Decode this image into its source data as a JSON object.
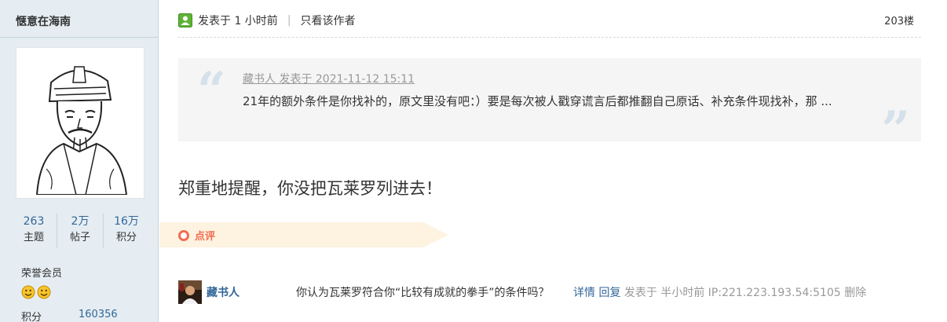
{
  "user": {
    "name": "惬意在海南",
    "stats": [
      {
        "value": "263",
        "label": "主题"
      },
      {
        "value": "2万",
        "label": "帖子"
      },
      {
        "value": "16万",
        "label": "积分"
      }
    ],
    "rank": "荣誉会员",
    "credit_label": "积分",
    "credit_value": "160356"
  },
  "post": {
    "posted_at": "发表于 1 小时前",
    "only_author": "只看该作者",
    "floor": "203楼",
    "quote": {
      "header": "藏书人 发表于 2021-11-12 15:11",
      "body": "21年的额外条件是你找补的，原文里没有吧：）要是每次被人戳穿谎言后都推翻自己原话、补充条件现找补，那 ..."
    },
    "content": "郑重地提醒，你没把瓦莱罗列进去！"
  },
  "comments": {
    "section_label": "点评",
    "items": [
      {
        "author": "藏书人",
        "text": "你认为瓦莱罗符合你“比较有成就的拳手”的条件吗？",
        "detail_link": "详情",
        "reply_link": "回复",
        "posted": "发表于 半小时前 IP:221.223.193.54:5105 删除"
      }
    ]
  },
  "colors": {
    "sidebar_bg": "#e5edf2",
    "link_blue": "#336699",
    "comment_accent": "#f26c4f",
    "comment_bar_bg": "#fdf3e0",
    "quote_bg": "#f5f5f5"
  }
}
